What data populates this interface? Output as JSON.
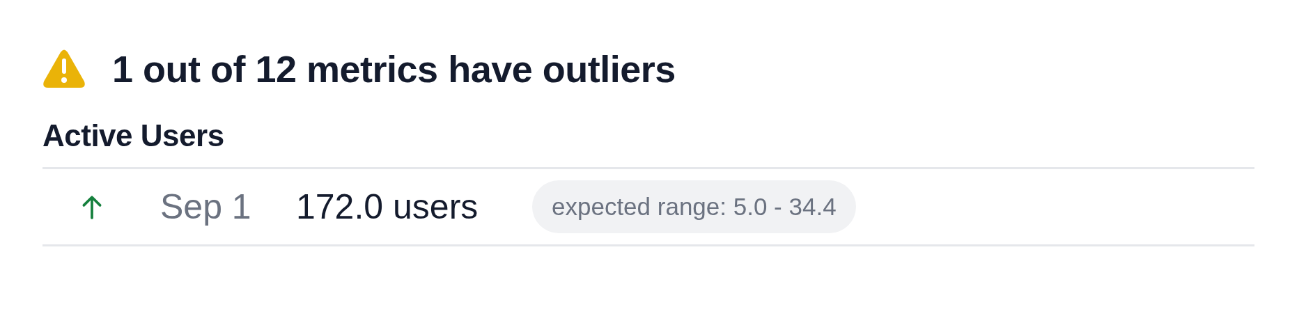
{
  "header": {
    "title": "1 out of 12 metrics have outliers"
  },
  "metrics": [
    {
      "name": "Active Users",
      "outliers": [
        {
          "increase": true,
          "date": "Sep 1",
          "value": "172.0 users",
          "range": "expected range: 5.0 - 34.4"
        }
      ]
    }
  ]
}
